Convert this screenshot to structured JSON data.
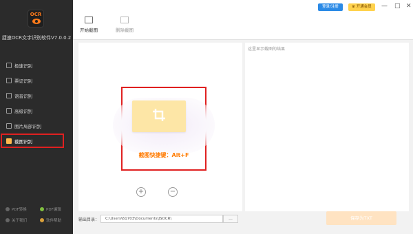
{
  "app": {
    "title": "捷速OCR文字识别软件V7.0.0.2",
    "logo_text": "OCR"
  },
  "sidebar": {
    "items": [
      {
        "label": "极速识别",
        "icon": "document-scan-icon",
        "active": false
      },
      {
        "label": "票证识别",
        "icon": "ticket-icon",
        "active": false
      },
      {
        "label": "语音识别",
        "icon": "voice-icon",
        "active": false
      },
      {
        "label": "高级识别",
        "icon": "advanced-icon",
        "active": false
      },
      {
        "label": "图片局部识别",
        "icon": "image-region-icon",
        "active": false
      },
      {
        "label": "截图识别",
        "icon": "screenshot-icon",
        "active": true
      }
    ],
    "bottom_links": [
      {
        "label": "PDF转换",
        "icon": "pdf-convert-icon",
        "color": "gray"
      },
      {
        "label": "PDF编辑",
        "icon": "pdf-edit-icon",
        "color": "green"
      },
      {
        "label": "关于我们",
        "icon": "about-icon",
        "color": "gray"
      },
      {
        "label": "软件帮助",
        "icon": "help-icon",
        "color": "orange"
      }
    ]
  },
  "toolbar": {
    "start_capture_label": "开始截图",
    "delete_capture_label": "删除截图"
  },
  "header": {
    "login_label": "登录/注册",
    "vip_label": "开通会员",
    "minimize": "—",
    "maximize": "□",
    "close": "✕"
  },
  "main": {
    "shortcut_text": "截图快捷键：Alt+F",
    "result_hint": "这里显示截图的结果",
    "zoom_in": "+",
    "zoom_out": "−"
  },
  "output": {
    "label": "输出目录：",
    "path": "C:\\Users\\61703\\Documents\\JSOCR\\",
    "browse_label": "...",
    "save_label": "保存为TXT"
  },
  "colors": {
    "sidebar_bg": "#2b2b2b",
    "accent_orange": "#ff7a00",
    "highlight_red": "#e02020",
    "login_blue": "#2b8ae6",
    "vip_yellow": "#ffd24d"
  }
}
